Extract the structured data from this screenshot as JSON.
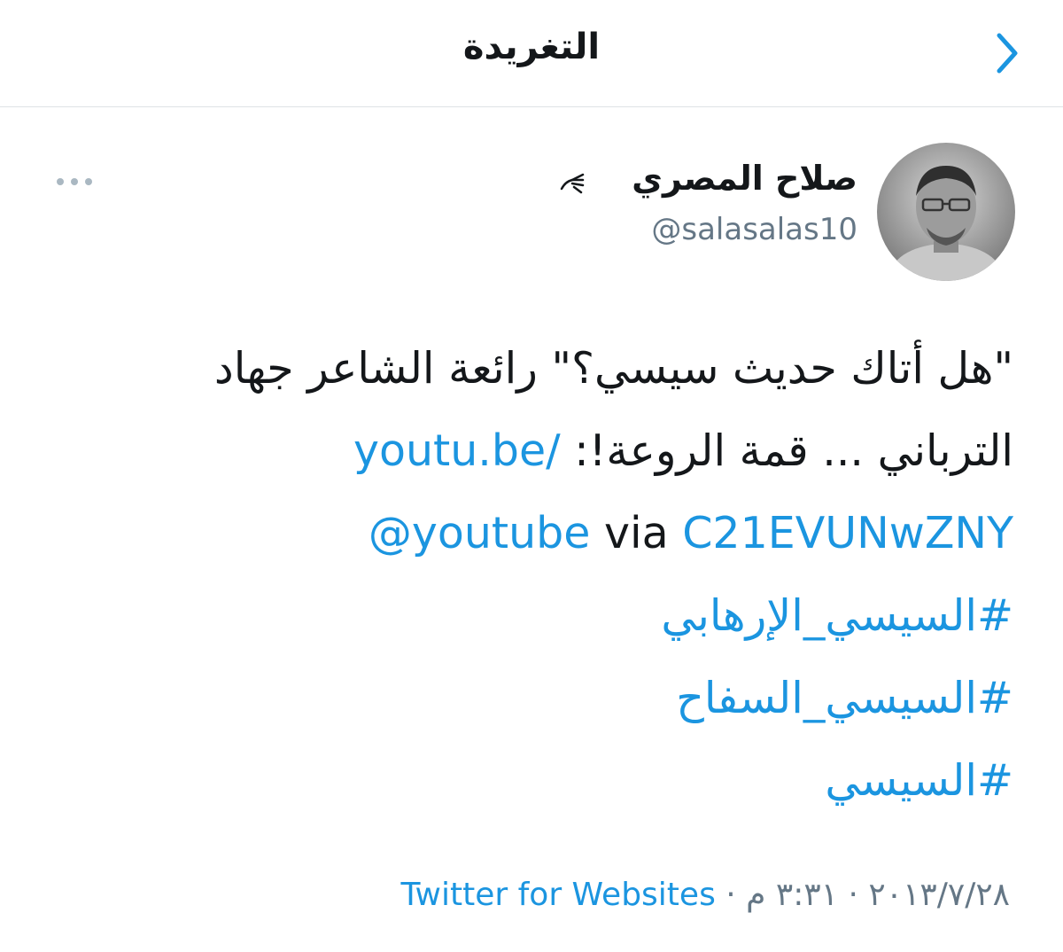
{
  "header": {
    "title": "التغريدة",
    "back_icon": "chevron-right-icon"
  },
  "tweet": {
    "author": {
      "display_name": "صلاح المصري",
      "name_emoji_icon": "hand-icon",
      "handle": "@salasalas10",
      "avatar_icon": "avatar-photo"
    },
    "more_icon": "more-dots-icon",
    "text": {
      "line1": "\"هل أتاك حديث سيسي؟\" رائعة الشاعر جهاد",
      "line2_text": "الترباني ... قمة الروعة!: ",
      "line2_link": "youtu.be/",
      "line3_link1": "C21EVUNwZNY",
      "line3_via": " via ",
      "line3_mention": "@youtube",
      "hashtags": [
        "#السيسي_الإرهابي",
        "#السيسي_السفاح",
        "#السيسي"
      ]
    },
    "meta": {
      "date": "٢٠١٣/٧/٢٨",
      "sep1": " · ",
      "time": "٣:٣١ م",
      "sep2": " · ",
      "source": "Twitter for Websites"
    }
  },
  "colors": {
    "link": "#1b95e0",
    "secondary_text": "#657786",
    "divider": "#dfe3e6"
  }
}
